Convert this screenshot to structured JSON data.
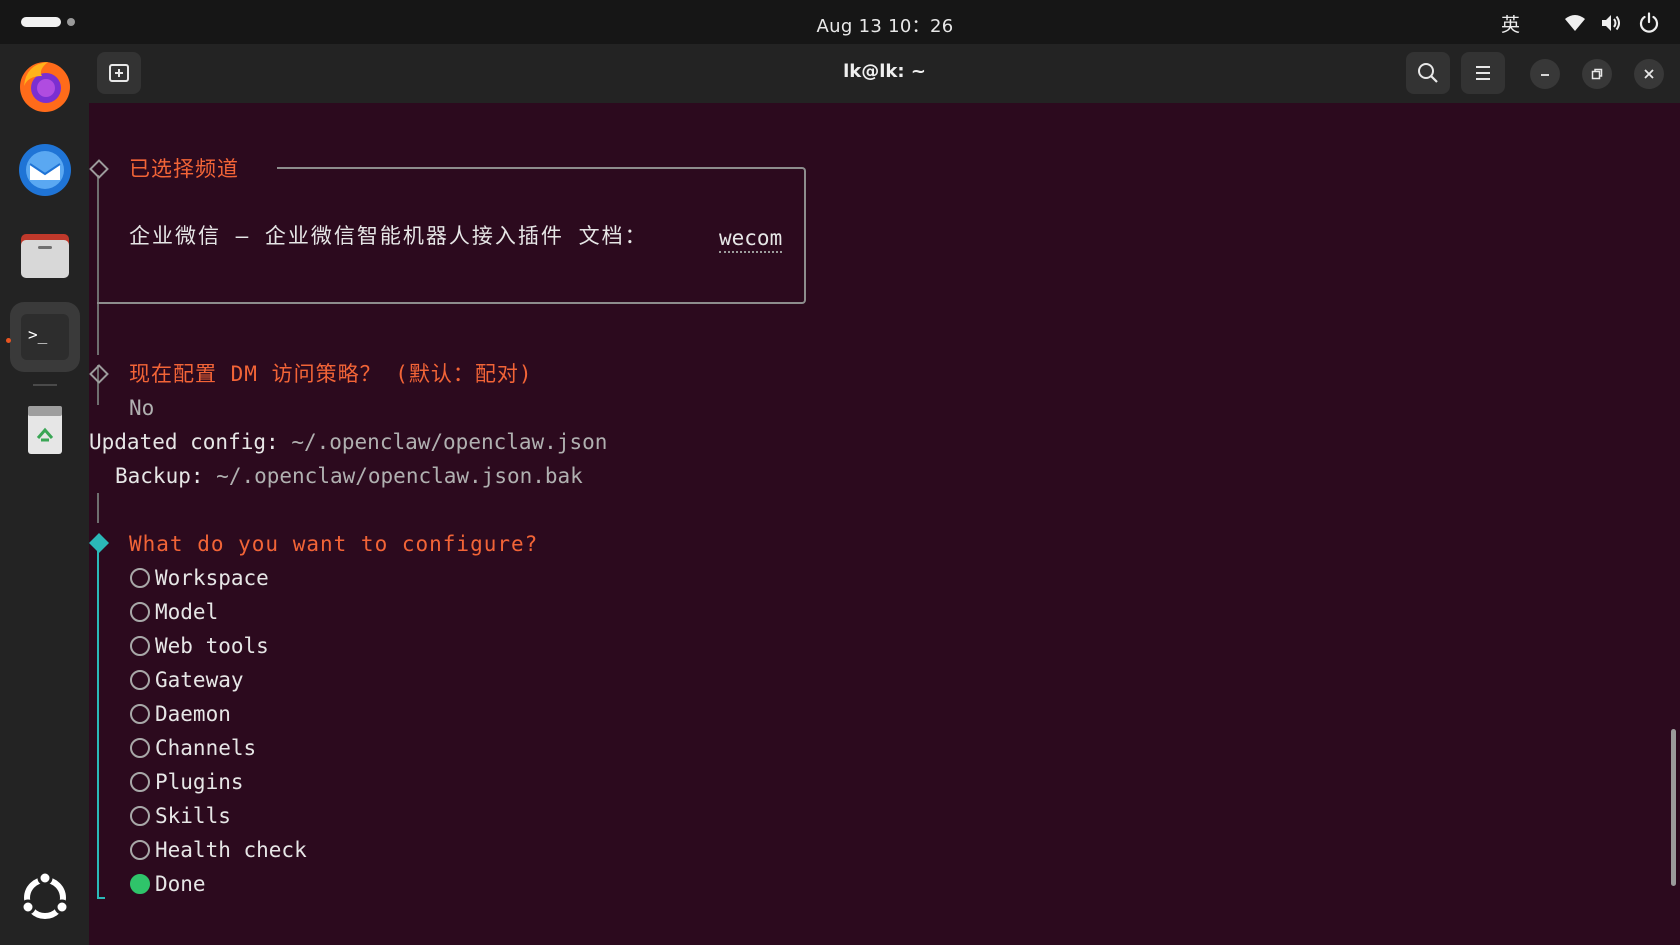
{
  "topbar": {
    "clock": "Aug 13  10：26",
    "input_method": "英",
    "icons": [
      "wifi-icon",
      "volume-icon",
      "power-icon"
    ]
  },
  "dock": {
    "items": [
      "firefox",
      "thunderbird",
      "files",
      "terminal",
      "trash",
      "show-apps"
    ]
  },
  "window": {
    "title": "lk@lk: ~"
  },
  "terminal": {
    "section1": {
      "heading": "已选择频道",
      "channel_text": "企业微信 — 企业微信智能机器人接入插件 文档：",
      "channel_link": "wecom"
    },
    "section2": {
      "question": "现在配置 DM 访问策略？ (默认：配对)",
      "answer": "No"
    },
    "updated": {
      "label": "Updated config:",
      "path": "~/.openclaw/openclaw.json"
    },
    "backup": {
      "label": "Backup:",
      "path": "~/.openclaw/openclaw.json.bak"
    },
    "prompt": {
      "question": "What do you want to configure?",
      "options": [
        "Workspace",
        "Model",
        "Web tools",
        "Gateway",
        "Daemon",
        "Channels",
        "Plugins",
        "Skills",
        "Health check",
        "Done"
      ],
      "selected": "Done"
    }
  },
  "colors": {
    "terminal_bg": "#2c0a1e",
    "accent_orange": "#f26437",
    "active_diamond": "#2bb8b8",
    "selected_radio": "#2fc46a"
  }
}
